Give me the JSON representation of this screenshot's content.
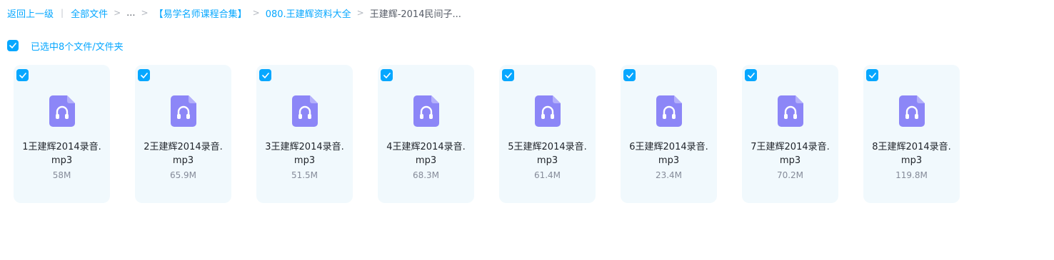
{
  "breadcrumb": {
    "back": "返回上一级",
    "all_files": "全部文件",
    "ellipsis": "...",
    "folder1": "【易学名师课程合集】",
    "folder2": "080.王建辉资料大全",
    "current": "王建辉-2014民间子..."
  },
  "selection": {
    "text": "已选中8个文件/文件夹"
  },
  "files": [
    {
      "name_line1": "1王建辉2014录音.",
      "name_line2": "mp3",
      "size": "58M"
    },
    {
      "name_line1": "2王建辉2014录音.",
      "name_line2": "mp3",
      "size": "65.9M"
    },
    {
      "name_line1": "3王建辉2014录音.",
      "name_line2": "mp3",
      "size": "51.5M"
    },
    {
      "name_line1": "4王建辉2014录音.",
      "name_line2": "mp3",
      "size": "68.3M"
    },
    {
      "name_line1": "5王建辉2014录音.",
      "name_line2": "mp3",
      "size": "61.4M"
    },
    {
      "name_line1": "6王建辉2014录音.",
      "name_line2": "mp3",
      "size": "23.4M"
    },
    {
      "name_line1": "7王建辉2014录音.",
      "name_line2": "mp3",
      "size": "70.2M"
    },
    {
      "name_line1": "8王建辉2014录音.",
      "name_line2": "mp3",
      "size": "119.8M"
    }
  ],
  "icons": {
    "file": "audio-file-icon",
    "check": "checkmark-icon"
  },
  "colors": {
    "accent": "#06a7ff",
    "card_bg": "#f1f9fd",
    "icon_purple": "#8c86f7"
  }
}
